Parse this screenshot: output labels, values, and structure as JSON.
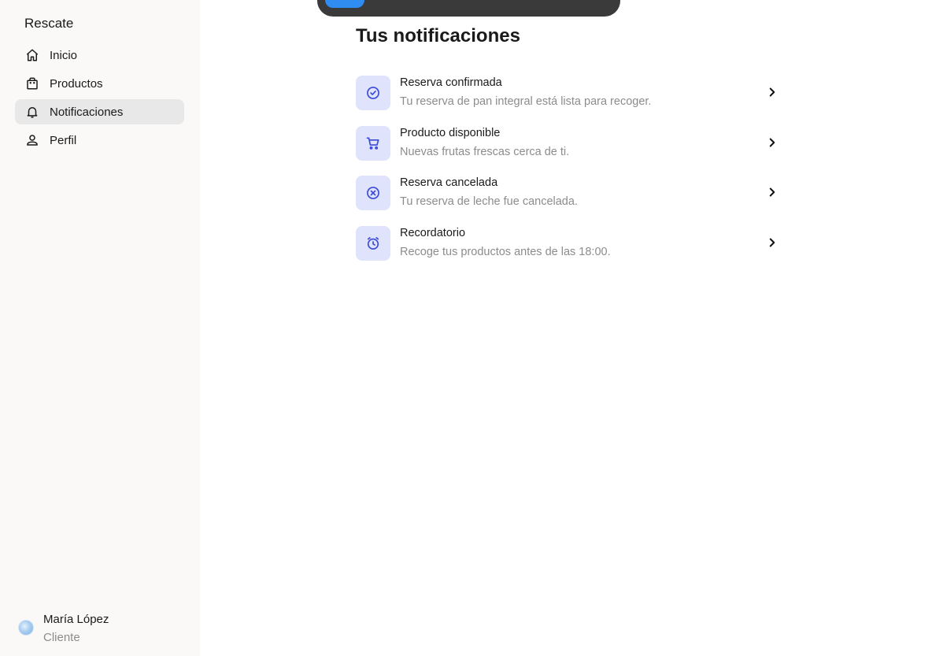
{
  "sidebar": {
    "brand": "Rescate",
    "items": [
      {
        "label": "Inicio",
        "icon": "home-icon"
      },
      {
        "label": "Productos",
        "icon": "shopping-bag-icon"
      },
      {
        "label": "Notificaciones",
        "icon": "bell-icon",
        "active": true
      },
      {
        "label": "Perfil",
        "icon": "person-icon"
      }
    ],
    "user": {
      "name": "María López",
      "role": "Cliente"
    }
  },
  "main": {
    "title": "Tus notificaciones",
    "notifications": [
      {
        "title": "Reserva confirmada",
        "description": "Tu reserva de pan integral está lista para recoger.",
        "icon": "check-circle-icon"
      },
      {
        "title": "Producto disponible",
        "description": "Nuevas frutas frescas cerca de ti.",
        "icon": "cart-icon"
      },
      {
        "title": "Reserva cancelada",
        "description": "Tu reserva de leche fue cancelada.",
        "icon": "x-circle-icon"
      },
      {
        "title": "Recordatorio",
        "description": "Recoge tus productos antes de las 18:00.",
        "icon": "alarm-clock-icon"
      }
    ]
  },
  "colors": {
    "sidebar_bg": "#faf9f7",
    "active_item_bg": "#e8e8e8",
    "icon_tile_bg": "#dfe3fb",
    "icon_accent": "#3b4bd8",
    "topbar_bg": "#3a3a3a",
    "topbar_accent": "#2f8cf0"
  }
}
